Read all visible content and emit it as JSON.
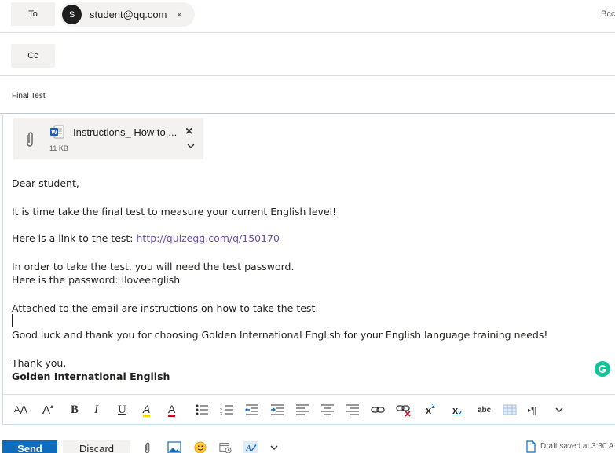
{
  "header": {
    "to_label": "To",
    "cc_label": "Cc",
    "bcc_label": "Bcc",
    "recipient": {
      "initial": "S",
      "email": "student@qq.com",
      "remove": "×"
    }
  },
  "subject": "Final Test",
  "attachment": {
    "filename": "Instructions_ How to ...",
    "size": "11 KB",
    "remove": "×"
  },
  "body": {
    "greeting": "Dear student,",
    "line1": "It is time take the final test to measure your current English level!",
    "line2_prefix": "Here is a link to the test: ",
    "link": "http://quizegg.com/q/150170",
    "line3": "In order to take the test, you will need the test password.",
    "line4": "Here is the password: iloveenglish",
    "line5": "Attached to the email are instructions on how to take the test.",
    "line6": "Good luck and thank you for choosing Golden International English for your English language training needs!",
    "closing": "Thank you,",
    "signature": "Golden International English"
  },
  "toolbar": {
    "font_size_glyph": "A",
    "grow_glyph": "A",
    "bold": "B",
    "italic": "I",
    "underline": "U",
    "highlight_glyph": "A",
    "font_color_glyph": "A",
    "superscript": "x",
    "subscript": "x",
    "strike": "abc",
    "paragraph": "¶",
    "more": "∨"
  },
  "actions": {
    "send": "Send",
    "discard": "Discard",
    "draft_status": "Draft saved at 3:30 A"
  },
  "colors": {
    "send_bg": "#0f6cbd",
    "link": "#6b4fbb",
    "grammarly": "#15c39a",
    "font_color_red": "#c50f1f",
    "highlight_yellow": "#ffd700",
    "word_blue": "#185abd"
  }
}
